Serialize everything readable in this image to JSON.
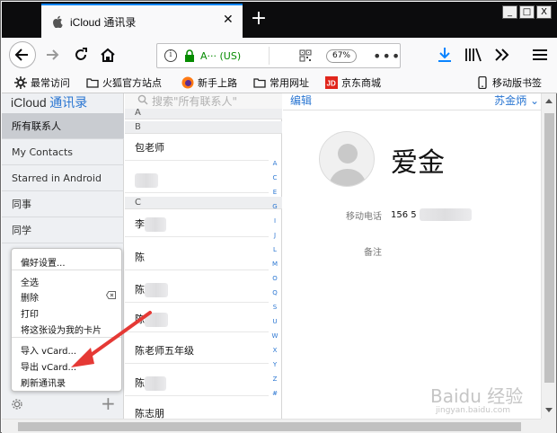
{
  "browser": {
    "tab_title": "iCloud 通讯录",
    "url_site": "A··· (US)",
    "zoom_level": "67%",
    "window_buttons": [
      "_",
      "□",
      "X"
    ]
  },
  "bookmarks": [
    {
      "label": "最常访问",
      "icon": "gear-icon"
    },
    {
      "label": "火狐官方站点",
      "icon": "folder-icon"
    },
    {
      "label": "新手上路",
      "icon": "firefox-icon"
    },
    {
      "label": "常用网址",
      "icon": "folder-icon"
    },
    {
      "label": "京东商城",
      "icon": "jd-icon"
    },
    {
      "label": "移动版书签",
      "icon": "mobile-icon"
    }
  ],
  "sidebar": {
    "brand": "iCloud",
    "app_name": "通讯录",
    "groups": [
      "所有联系人",
      "My Contacts",
      "Starred in Android",
      "同事",
      "同学"
    ]
  },
  "context_menu": {
    "items": [
      "偏好设置...",
      "全选",
      "删除",
      "打印",
      "将这张设为我的卡片",
      "导入 vCard...",
      "导出 vCard...",
      "刷新通讯录"
    ]
  },
  "contact_list": {
    "search_placeholder": "搜索\"所有联系人\"",
    "section_a": "A",
    "section_b": "B",
    "section_c": "C",
    "rows": [
      "包老师",
      "",
      "",
      "陈",
      "陈",
      "陈",
      "陈老师五年级",
      "陈",
      "陈志朋"
    ],
    "row_prefixes": [
      "",
      "",
      "李",
      "",
      "",
      "",
      "",
      "",
      ""
    ],
    "alphabet": [
      "A",
      "C",
      "E",
      "G",
      "I",
      "J",
      "L",
      "M",
      "O",
      "Q",
      "S",
      "U",
      "W",
      "X",
      "Y",
      "Z",
      "#"
    ]
  },
  "detail": {
    "edit_label": "编辑",
    "user_menu": "苏金炳",
    "name": "爱金",
    "phone_label": "移动电话",
    "phone_value": "156 5",
    "note_label": "备注"
  },
  "watermark": {
    "text": "Baidu 经验",
    "url": "jingyan.baidu.com"
  },
  "colors": {
    "accent": "#2a76d2",
    "annotation": "#e53935",
    "secure": "#058b00"
  }
}
